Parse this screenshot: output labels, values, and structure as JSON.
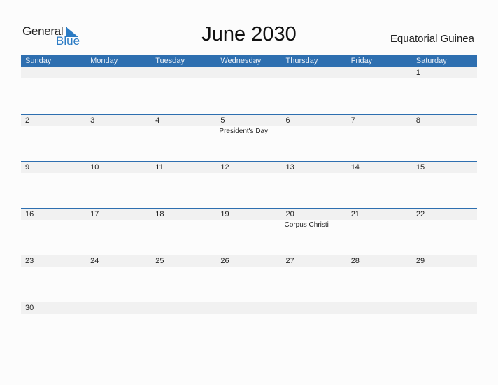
{
  "logo": {
    "general": "General",
    "blue": "Blue"
  },
  "title": "June 2030",
  "country": "Equatorial Guinea",
  "colors": {
    "accent": "#2e6fb0",
    "band": "#f1f1f1"
  },
  "weekdays": [
    "Sunday",
    "Monday",
    "Tuesday",
    "Wednesday",
    "Thursday",
    "Friday",
    "Saturday"
  ],
  "weeks": [
    [
      {
        "day": ""
      },
      {
        "day": ""
      },
      {
        "day": ""
      },
      {
        "day": ""
      },
      {
        "day": ""
      },
      {
        "day": ""
      },
      {
        "day": "1"
      }
    ],
    [
      {
        "day": "2"
      },
      {
        "day": "3"
      },
      {
        "day": "4"
      },
      {
        "day": "5",
        "holiday": "President's Day"
      },
      {
        "day": "6"
      },
      {
        "day": "7"
      },
      {
        "day": "8"
      }
    ],
    [
      {
        "day": "9"
      },
      {
        "day": "10"
      },
      {
        "day": "11"
      },
      {
        "day": "12"
      },
      {
        "day": "13"
      },
      {
        "day": "14"
      },
      {
        "day": "15"
      }
    ],
    [
      {
        "day": "16"
      },
      {
        "day": "17"
      },
      {
        "day": "18"
      },
      {
        "day": "19"
      },
      {
        "day": "20",
        "holiday": "Corpus Christi"
      },
      {
        "day": "21"
      },
      {
        "day": "22"
      }
    ],
    [
      {
        "day": "23"
      },
      {
        "day": "24"
      },
      {
        "day": "25"
      },
      {
        "day": "26"
      },
      {
        "day": "27"
      },
      {
        "day": "28"
      },
      {
        "day": "29"
      }
    ],
    [
      {
        "day": "30"
      },
      {
        "day": ""
      },
      {
        "day": ""
      },
      {
        "day": ""
      },
      {
        "day": ""
      },
      {
        "day": ""
      },
      {
        "day": ""
      }
    ]
  ]
}
